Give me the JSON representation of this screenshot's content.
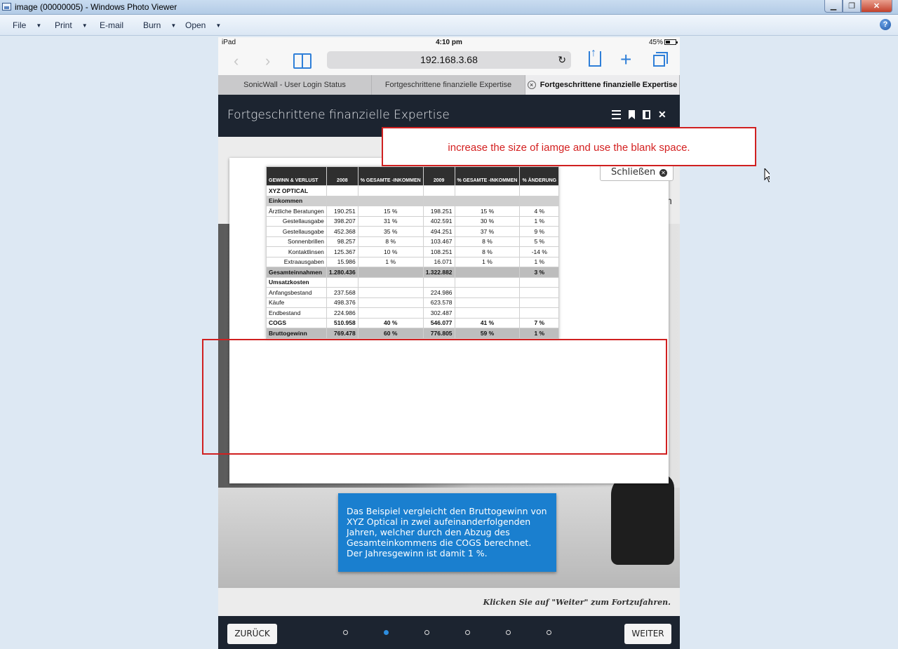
{
  "window": {
    "title": "image (00000005) - Windows Photo Viewer",
    "controls": [
      "minimize",
      "maximize",
      "close"
    ]
  },
  "menu": [
    {
      "label": "File",
      "dropdown": true
    },
    {
      "label": "Print",
      "dropdown": true
    },
    {
      "label": "E-mail",
      "dropdown": false
    },
    {
      "label": "Burn",
      "dropdown": true
    },
    {
      "label": "Open",
      "dropdown": true
    }
  ],
  "help_icon": "?",
  "ipad": {
    "status": {
      "device": "iPad",
      "time": "4:10 pm",
      "battery": "45%"
    },
    "url": "192.168.3.68",
    "tabs": [
      {
        "label": "SonicWall - User Login Status",
        "active": false
      },
      {
        "label": "Fortgeschrittene finanzielle Expertise",
        "active": false
      },
      {
        "label": "Fortgeschrittene finanzielle Expertise",
        "active": true
      }
    ],
    "tab_close_glyph": "×",
    "course_title": "Fortgeschrittene finanzielle Expertise",
    "close_label": "Schließen",
    "peek_letter": "n",
    "table": {
      "headers": [
        "GEWINN & VERLUST",
        "2008",
        "% GESAMTE -INKOMMEN",
        "2009",
        "% GESAMTE -INKOMMEN",
        "% ÄNDERUNG"
      ],
      "company": "XYZ OPTICAL",
      "income_header": "Einkommen",
      "income_rows": [
        [
          "Ärztliche Beratungen",
          "190.251",
          "15 %",
          "198.251",
          "15 %",
          "4 %"
        ],
        [
          "Gestellausgabe",
          "398.207",
          "31 %",
          "402.591",
          "30 %",
          "1 %"
        ],
        [
          "Gestellausgabe",
          "452.368",
          "35 %",
          "494.251",
          "37 %",
          "9 %"
        ],
        [
          "Sonnenbrillen",
          "98.257",
          "8 %",
          "103.467",
          "8 %",
          "5 %"
        ],
        [
          "Kontaktlinsen",
          "125.367",
          "10 %",
          "108.251",
          "8 %",
          "-14 %"
        ],
        [
          "Extraausgaben",
          "15.986",
          "1 %",
          "16.071",
          "1 %",
          "1 %"
        ]
      ],
      "total_income": [
        "Gesamteinnahmen",
        "1.280.436",
        "",
        "1.322.882",
        "",
        "3 %"
      ],
      "cogs_header": "Umsatzkosten",
      "cogs_rows": [
        [
          "Anfangsbestand",
          "237.568",
          "",
          "224.986",
          "",
          ""
        ],
        [
          "Käufe",
          "498.376",
          "",
          "623.578",
          "",
          ""
        ],
        [
          "Endbestand",
          "224.986",
          "",
          "302.487",
          "",
          ""
        ]
      ],
      "cogs_total": [
        "COGS",
        "510.958",
        "40 %",
        "546.077",
        "41 %",
        "7 %"
      ],
      "gross_profit": [
        "Bruttogewinn",
        "769.478",
        "60 %",
        "776.805",
        "59 %",
        "1 %"
      ]
    },
    "info_text": "Das Beispiel vergleicht den Bruttogewinn von XYZ Optical in zwei aufeinanderfolgenden Jahren, welcher durch den Abzug des Gesamteinkommens die COGS berechnet. Der Jahresgewinn ist damit 1 %.",
    "hint": "Klicken Sie auf \"Weiter\" zum Fortzufahren.",
    "back_label": "ZURÜCK",
    "next_label": "WEITER",
    "pager": {
      "total": 6,
      "active_index": 1
    }
  },
  "annotation": {
    "note": "increase the size of iamge and use the blank space.",
    "color": "#d02020"
  }
}
